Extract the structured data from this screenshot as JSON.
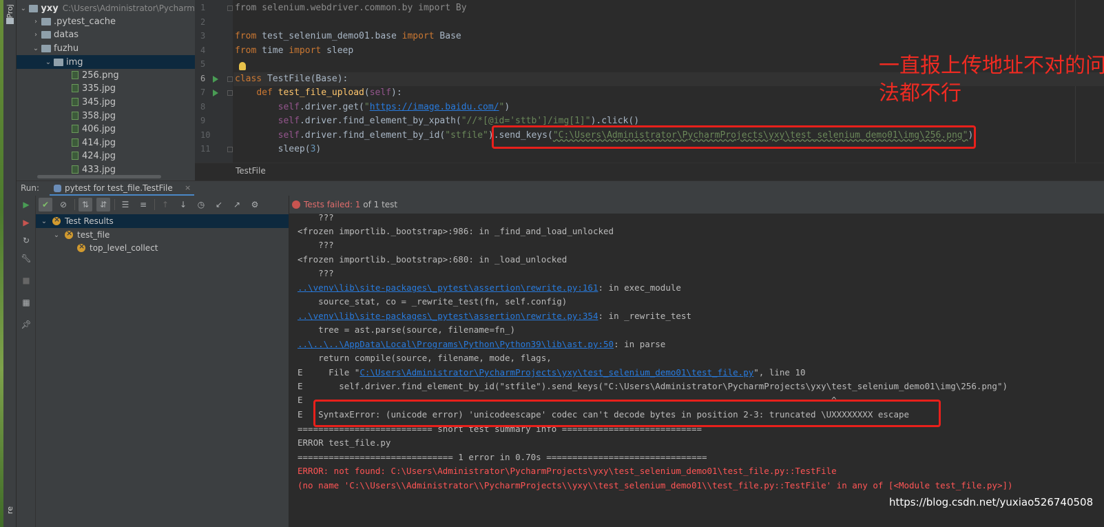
{
  "sidebar": {
    "vertical_label": "Proj",
    "vertical_label_bottom": "re"
  },
  "project_tree": {
    "items": [
      {
        "name": "yxy",
        "path": "C:\\Users\\Administrator\\Pycharm"
      },
      {
        "name": ".pytest_cache"
      },
      {
        "name": "datas"
      },
      {
        "name": "fuzhu"
      },
      {
        "name": "img"
      },
      {
        "name": "256.png"
      },
      {
        "name": "335.jpg"
      },
      {
        "name": "345.jpg"
      },
      {
        "name": "358.jpg"
      },
      {
        "name": "406.jpg"
      },
      {
        "name": "414.jpg"
      },
      {
        "name": "424.jpg"
      },
      {
        "name": "433.jpg"
      }
    ]
  },
  "editor": {
    "line_numbers": [
      "1",
      "2",
      "3",
      "4",
      "5",
      "6",
      "7",
      "8",
      "9",
      "10",
      "11"
    ],
    "code": {
      "l1": {
        "a": "from",
        "b": " selenium.webdriver.common.by ",
        "c": "import",
        "d": " By"
      },
      "l3": {
        "a": "from",
        "b": " test_selenium_demo01.base ",
        "c": "import",
        "d": " Base"
      },
      "l4": {
        "a": "from",
        "b": " time ",
        "c": "import",
        "d": " sleep"
      },
      "l6": {
        "a": "class",
        "b": " TestFile(Base):"
      },
      "l7": {
        "indent": "    ",
        "a": "def",
        "b": " ",
        "c": "test_file_upload",
        "d": "(",
        "e": "self",
        "f": "):"
      },
      "l8": {
        "indent": "        ",
        "a": "self",
        "b": ".driver.get(",
        "c": "\"",
        "d": "https://image.baidu.com/",
        "e": "\"",
        "f": ")"
      },
      "l9": {
        "indent": "        ",
        "a": "self",
        "b": ".driver.find_element_by_xpath(",
        "c": "\"//*[@id='sttb']/img[1]\"",
        "d": ").click()"
      },
      "l10": {
        "indent": "        ",
        "a": "self",
        "b": ".driver.find_element_by_id(",
        "c": "\"stfile\"",
        "d": ").send_keys(",
        "e": "\"C:\\Users\\Administrator\\PycharmProjects\\yxy\\test_selenium_demo01\\img\\256.png\"",
        "f": ")"
      },
      "l11": {
        "indent": "        ",
        "a": "sleep(",
        "b": "3",
        "c": ")"
      }
    },
    "breadcrumb": "TestFile",
    "annotation": "一直报上传地址不对的问题，试了很多方法都不行"
  },
  "run_panel": {
    "label": "Run:",
    "tab_label": "pytest for test_file.TestFile",
    "tab_close": "×",
    "status_failed": "Tests failed: 1",
    "status_rest": " of 1 test",
    "results": [
      {
        "name": "Test Results"
      },
      {
        "name": "test_file"
      },
      {
        "name": "top_level_collect"
      }
    ]
  },
  "console": {
    "lines": [
      {
        "t": "    ???"
      },
      {
        "t": "<frozen importlib._bootstrap>:986: in _find_and_load_unlocked"
      },
      {
        "t": "    ???"
      },
      {
        "t": "<frozen importlib._bootstrap>:680: in _load_unlocked"
      },
      {
        "t": "    ???"
      },
      {
        "link": "..\\venv\\lib\\site-packages\\_pytest\\assertion\\rewrite.py:161",
        "t": ": in exec_module"
      },
      {
        "t": "    source_stat, co = _rewrite_test(fn, self.config)"
      },
      {
        "link": "..\\venv\\lib\\site-packages\\_pytest\\assertion\\rewrite.py:354",
        "t": ": in _rewrite_test"
      },
      {
        "t": "    tree = ast.parse(source, filename=fn_)"
      },
      {
        "link": "..\\..\\..\\AppData\\Local\\Programs\\Python\\Python39\\lib\\ast.py:50",
        "t": ": in parse"
      },
      {
        "t": "    return compile(source, filename, mode, flags,"
      },
      {
        "pre": "E     File \"",
        "link": "C:\\Users\\Administrator\\PycharmProjects\\yxy\\test_selenium_demo01\\test_file.py",
        "t": "\", line 10"
      },
      {
        "t": "E       self.driver.find_element_by_id(\"stfile\").send_keys(\"C:\\Users\\Administrator\\PycharmProjects\\yxy\\test_selenium_demo01\\img\\256.png\")"
      },
      {
        "t": "E                                                                                                      ^"
      },
      {
        "t": "E   SyntaxError: (unicode error) 'unicodeescape' codec can't decode bytes in position 2-3: truncated \\UXXXXXXXX escape"
      },
      {
        "t": "========================== short test summary info ==========================="
      },
      {
        "t": "ERROR test_file.py"
      },
      {
        "t": "============================== 1 error in 0.70s ==============================="
      },
      {
        "t": "ERROR: not found: C:\\Users\\Administrator\\PycharmProjects\\yxy\\test_selenium_demo01\\test_file.py::TestFile",
        "err": true
      },
      {
        "t": "(no name 'C:\\\\Users\\\\Administrator\\\\PycharmProjects\\\\yxy\\\\test_selenium_demo01\\\\test_file.py::TestFile' in any of [<Module test_file.py>])",
        "err": true
      }
    ]
  },
  "watermark": "https://blog.csdn.net/yuxiao526740508",
  "colors": {
    "highlight_box": "#e8201b",
    "annotation": "#ef2b22",
    "error_text": "#ff5555",
    "link": "#287bde"
  }
}
